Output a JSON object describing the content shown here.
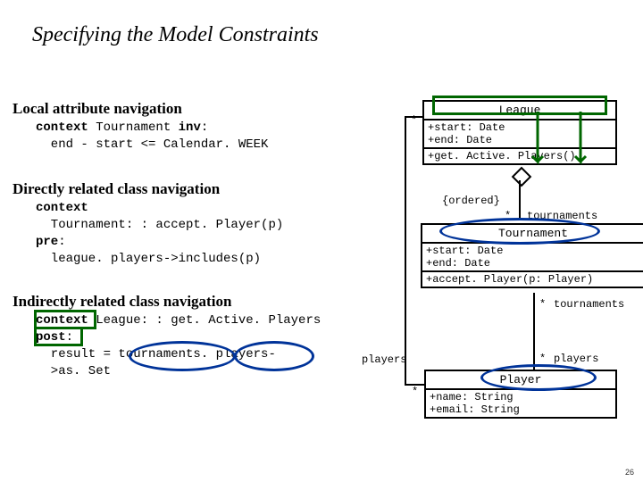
{
  "title": "Specifying the Model Constraints",
  "page_number": "26",
  "sections": {
    "s1": {
      "heading": "Local attribute navigation",
      "code_html": "<span class='kw'>context</span> Tournament <span class='kw'>inv</span>:\n  end - start <= Calendar. WEEK"
    },
    "s2": {
      "heading": "Directly related class navigation",
      "code_html": "<span class='kw'>context</span>\n  Tournament: : accept. Player(p)\n<span class='kw'>pre</span>:\n  league. players->includes(p)"
    },
    "s3": {
      "heading": "Indirectly related class navigation",
      "code_html": "<span class='kw'>context</span> League: : get. Active. Players\n<span class='kw'>post</span>:\n  result = tournaments. players-\n  >as. Set"
    }
  },
  "uml": {
    "league": {
      "name": "League",
      "attrs": "+start: Date\n+end: Date",
      "ops": "+get. Active. Players()"
    },
    "tournament": {
      "name": "Tournament",
      "attrs": "+start: Date\n+end: Date",
      "ops": "+accept. Player(p: Player)"
    },
    "player": {
      "name": "Player",
      "attrs": "+name: String\n+email: String"
    }
  },
  "labels": {
    "ordered": "{ordered}",
    "tournaments": "tournaments",
    "players": "players",
    "star": "*"
  }
}
